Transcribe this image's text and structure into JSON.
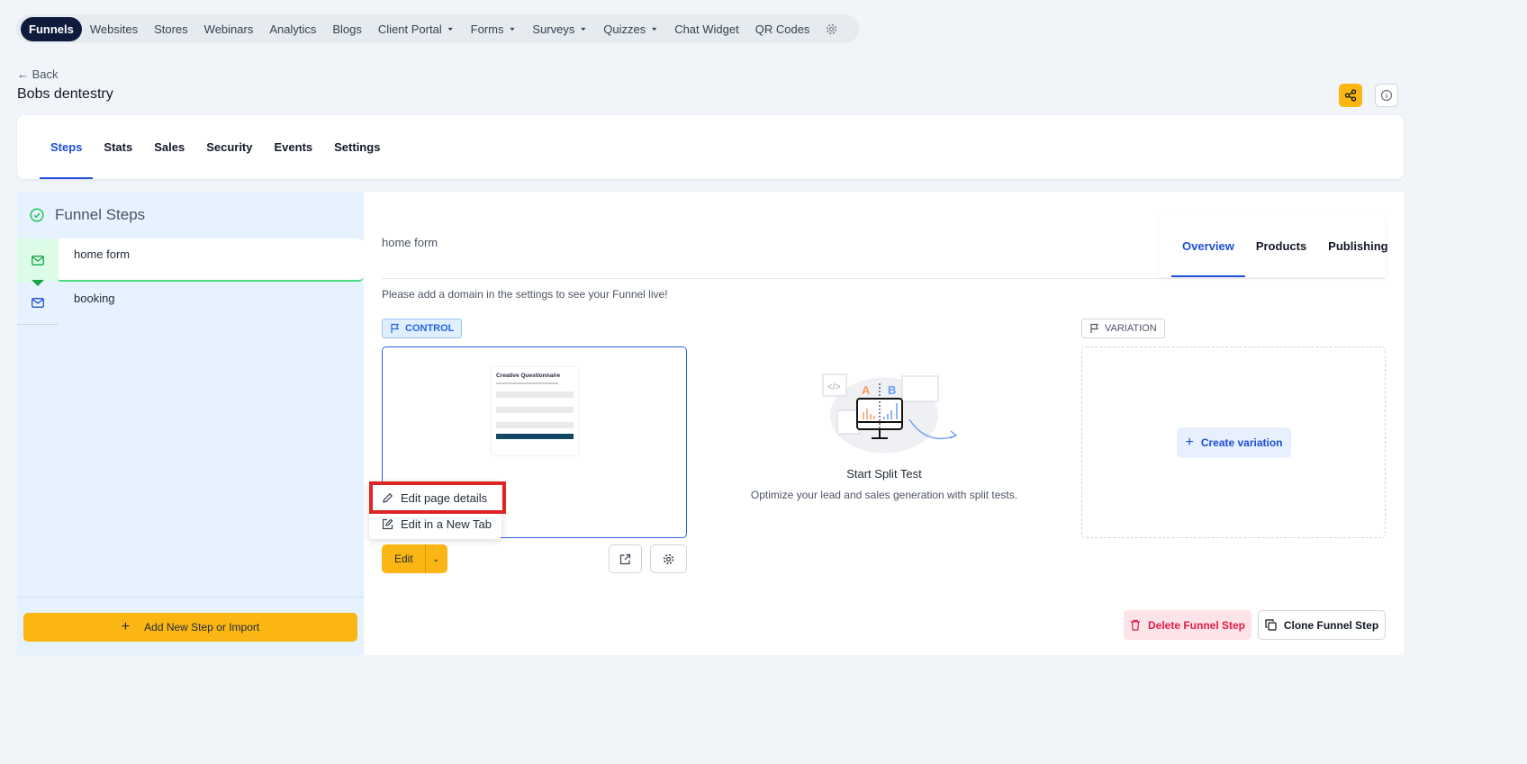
{
  "topnav": {
    "items": [
      {
        "label": "Funnels",
        "active": true
      },
      {
        "label": "Websites"
      },
      {
        "label": "Stores"
      },
      {
        "label": "Webinars"
      },
      {
        "label": "Analytics"
      },
      {
        "label": "Blogs"
      },
      {
        "label": "Client Portal",
        "dropdown": true
      },
      {
        "label": "Forms",
        "dropdown": true
      },
      {
        "label": "Surveys",
        "dropdown": true
      },
      {
        "label": "Quizzes",
        "dropdown": true
      },
      {
        "label": "Chat Widget"
      },
      {
        "label": "QR Codes"
      }
    ]
  },
  "header": {
    "back": "← Back",
    "title": "Bobs dentestry"
  },
  "tabs": [
    "Steps",
    "Stats",
    "Sales",
    "Security",
    "Events",
    "Settings"
  ],
  "sidebar": {
    "title": "Funnel Steps",
    "steps": [
      "home form",
      "booking"
    ],
    "add_button": "Add New Step or Import"
  },
  "main": {
    "step_name": "home form",
    "subtabs": [
      "Overview",
      "Products",
      "Publishing"
    ],
    "notice": "Please add a domain in the settings to see your Funnel live!",
    "control_label": "CONTROL",
    "variation_label": "VARIATION",
    "preview": {
      "title": "Creative Questionnaire"
    },
    "menu": [
      "Edit page details",
      "Edit in a New Tab"
    ],
    "edit_button": "Edit",
    "split": {
      "title": "Start Split Test",
      "subtitle": "Optimize your lead and sales generation with split tests."
    },
    "create_variation": "Create variation",
    "delete_button": "Delete Funnel Step",
    "clone_button": "Clone Funnel Step"
  },
  "colors": {
    "accent": "#fbb614",
    "primary": "#1d4ed8",
    "nav_active": "#0f1b3d",
    "danger": "#e11d48"
  }
}
